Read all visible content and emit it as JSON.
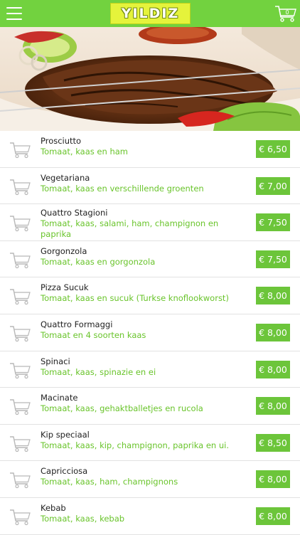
{
  "header": {
    "logo_text": "YILDIZ",
    "cart_count": "0",
    "icons": {
      "menu": "hamburger-icon",
      "cart": "shopping-cart-icon"
    }
  },
  "colors": {
    "accent": "#72d23f",
    "price_bg": "#6cc53a",
    "desc_text": "#69c42b",
    "logo_bg": "#e5f33b"
  },
  "menu": {
    "items": [
      {
        "name": "Prosciutto",
        "desc": "Tomaat, kaas en ham",
        "price": "€ 6,50"
      },
      {
        "name": "Vegetariana",
        "desc": "Tomaat, kaas en verschillende groenten",
        "price": "€ 7,00"
      },
      {
        "name": "Quattro Stagioni",
        "desc": "Tomaat, kaas, salami, ham, champignon en paprika",
        "price": "€ 7,50"
      },
      {
        "name": "Gorgonzola",
        "desc": "Tomaat, kaas en gorgonzola",
        "price": "€ 7,50"
      },
      {
        "name": "Pizza Sucuk",
        "desc": "Tomaat, kaas en sucuk (Turkse knoflookworst)",
        "price": "€ 8,00"
      },
      {
        "name": "Quattro Formaggi",
        "desc": "Tomaat en 4 soorten kaas",
        "price": "€ 8,00"
      },
      {
        "name": "Spinaci",
        "desc": "Tomaat, kaas, spinazie en ei",
        "price": "€ 8,00"
      },
      {
        "name": "Macinate",
        "desc": "Tomaat, kaas, gehaktballetjes en rucola",
        "price": "€ 8,00"
      },
      {
        "name": "Kip speciaal",
        "desc": "Tomaat, kaas, kip, champignon, paprika en ui.",
        "price": "€ 8,50"
      },
      {
        "name": "Capricciosa",
        "desc": "Tomaat, kaas, ham, champignons",
        "price": "€ 8,00"
      },
      {
        "name": "Kebab",
        "desc": "Tomaat, kaas, kebab",
        "price": "€ 8,00"
      }
    ]
  }
}
